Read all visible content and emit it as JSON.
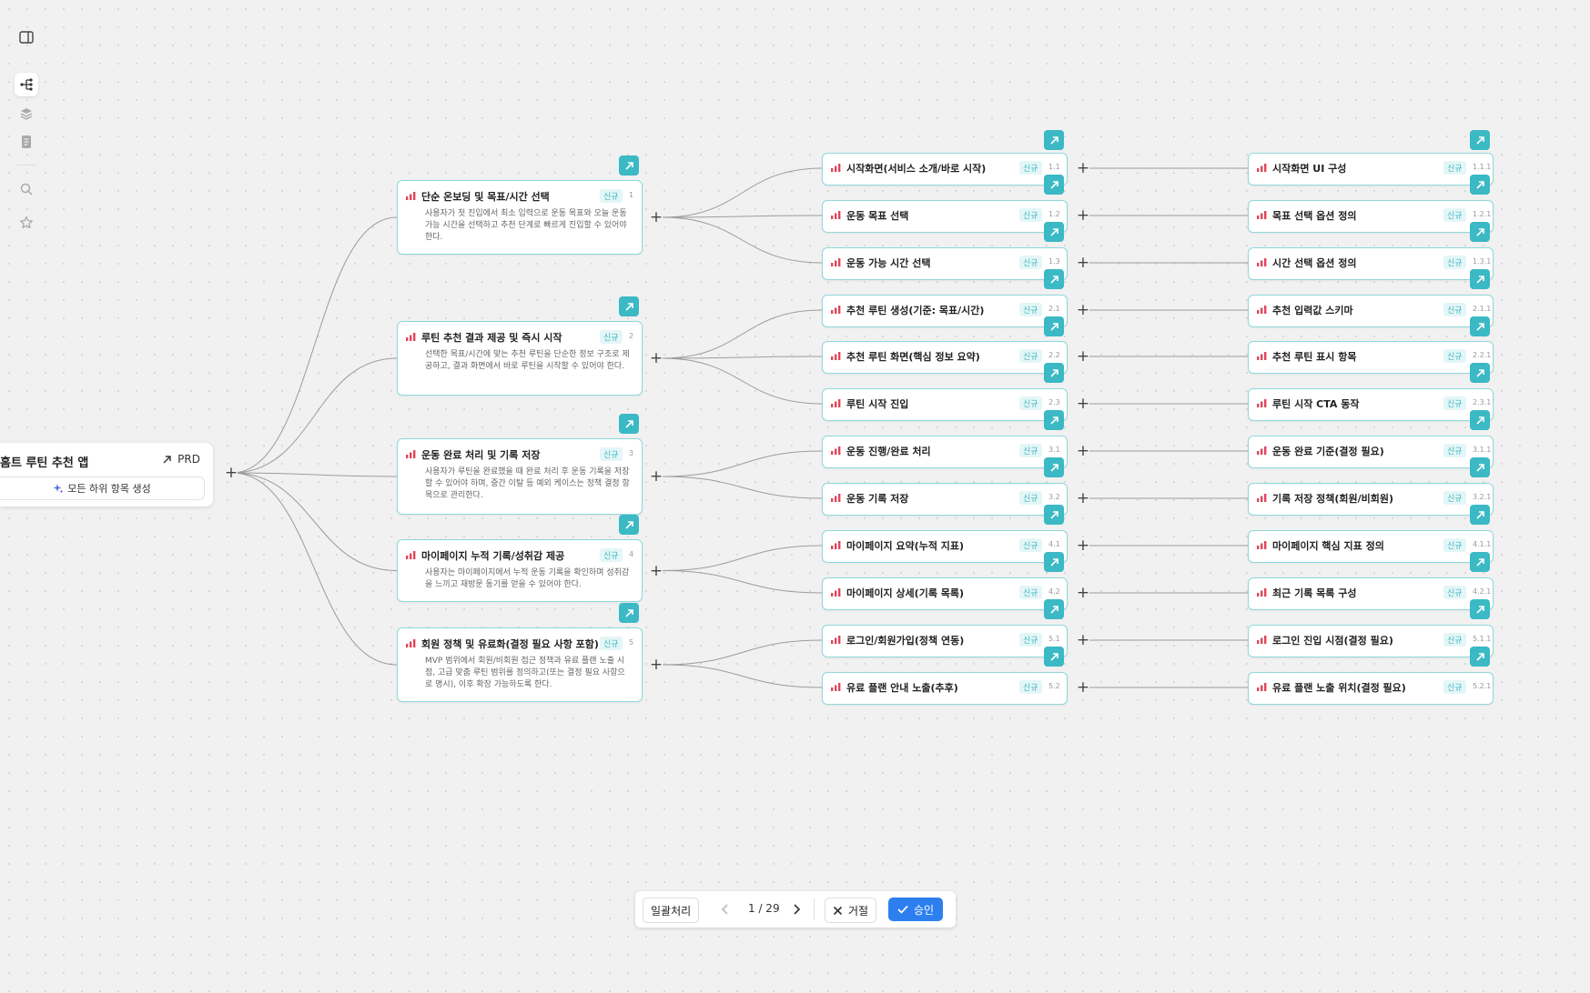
{
  "root": {
    "title": "홈트 루틴 추천 앱",
    "prd_label": "PRD",
    "generate_label": "모든 하위 항목 생성"
  },
  "level1": [
    {
      "title": "단순 온보딩 및 목표/시간 선택",
      "badge": "신규",
      "num": "1",
      "desc": "사용자가 첫 진입에서 최소 입력으로 운동 목표와 오늘 운동 가능 시간을 선택하고 추천 단계로 빠르게 진입할 수 있어야 한다."
    },
    {
      "title": "루틴 추천 결과 제공 및 즉시 시작",
      "badge": "신규",
      "num": "2",
      "desc": "선택한 목표/시간에 맞는 추천 루틴을 단순한 정보 구조로 제공하고, 결과 화면에서 바로 루틴을 시작할 수 있어야 한다."
    },
    {
      "title": "운동 완료 처리 및 기록 저장",
      "badge": "신규",
      "num": "3",
      "desc": "사용자가 루틴을 완료했을 때 완료 처리 후 운동 기록을 저장할 수 있어야 하며, 중간 이탈 등 예외 케이스는 정책 결정 항목으로 관리한다."
    },
    {
      "title": "마이페이지 누적 기록/성취감 제공",
      "badge": "신규",
      "num": "4",
      "desc": "사용자는 마이페이지에서 누적 운동 기록을 확인하며 성취감을 느끼고 재방문 동기를 얻을 수 있어야 한다."
    },
    {
      "title": "회원 정책 및 유료화(결정 필요 사항 포함)",
      "badge": "신규",
      "num": "5",
      "desc": "MVP 범위에서 회원/비회원 접근 정책과 유료 플랜 노출 시점, 고급 맞춤 루틴 범위를 정의하고(또는 결정 필요 사항으로 명시), 이후 확장 가능하도록 한다."
    }
  ],
  "level2": [
    {
      "title": "시작화면(서비스 소개/바로 시작)",
      "badge": "신규",
      "num": "1.1"
    },
    {
      "title": "운동 목표 선택",
      "badge": "신규",
      "num": "1.2"
    },
    {
      "title": "운동 가능 시간 선택",
      "badge": "신규",
      "num": "1.3"
    },
    {
      "title": "추천 루틴 생성(기준: 목표/시간)",
      "badge": "신규",
      "num": "2.1"
    },
    {
      "title": "추천 루틴 화면(핵심 정보 요약)",
      "badge": "신규",
      "num": "2.2"
    },
    {
      "title": "루틴 시작 진입",
      "badge": "신규",
      "num": "2.3"
    },
    {
      "title": "운동 진행/완료 처리",
      "badge": "신규",
      "num": "3.1"
    },
    {
      "title": "운동 기록 저장",
      "badge": "신규",
      "num": "3.2"
    },
    {
      "title": "마이페이지 요약(누적 지표)",
      "badge": "신규",
      "num": "4.1"
    },
    {
      "title": "마이페이지 상세(기록 목록)",
      "badge": "신규",
      "num": "4.2"
    },
    {
      "title": "로그인/회원가입(정책 연동)",
      "badge": "신규",
      "num": "5.1"
    },
    {
      "title": "유료 플랜 안내 노출(추후)",
      "badge": "신규",
      "num": "5.2"
    }
  ],
  "level3": [
    {
      "title": "시작화면 UI 구성",
      "badge": "신규",
      "num": "1.1.1"
    },
    {
      "title": "목표 선택 옵션 정의",
      "badge": "신규",
      "num": "1.2.1"
    },
    {
      "title": "시간 선택 옵션 정의",
      "badge": "신규",
      "num": "1.3.1"
    },
    {
      "title": "추천 입력값 스키마",
      "badge": "신규",
      "num": "2.1.1"
    },
    {
      "title": "추천 루틴 표시 항목",
      "badge": "신규",
      "num": "2.2.1"
    },
    {
      "title": "루틴 시작 CTA 동작",
      "badge": "신규",
      "num": "2.3.1"
    },
    {
      "title": "운동 완료 기준(결정 필요)",
      "badge": "신규",
      "num": "3.1.1"
    },
    {
      "title": "기록 저장 정책(회원/비회원)",
      "badge": "신규",
      "num": "3.2.1"
    },
    {
      "title": "마이페이지 핵심 지표 정의",
      "badge": "신규",
      "num": "4.1.1"
    },
    {
      "title": "최근 기록 목록 구성",
      "badge": "신규",
      "num": "4.2.1"
    },
    {
      "title": "로그인 진입 시점(결정 필요)",
      "badge": "신규",
      "num": "5.1.1"
    },
    {
      "title": "유료 플랜 노출 위치(결정 필요)",
      "badge": "신규",
      "num": "5.2.1"
    }
  ],
  "toolbar": {
    "batch_label": "일괄처리",
    "page_label": "1 / 29",
    "reject_label": "거절",
    "approve_label": "승인"
  },
  "colors": {
    "accent": "#3bb9c4",
    "card_border": "#8fd8dc",
    "priority_high": "#e0445a",
    "approve": "#2d7ff0"
  },
  "icons": {
    "sidebar": [
      "sidebar-toggle-icon",
      "tree-icon",
      "layers-icon",
      "document-icon",
      "search-icon",
      "star-icon"
    ]
  }
}
